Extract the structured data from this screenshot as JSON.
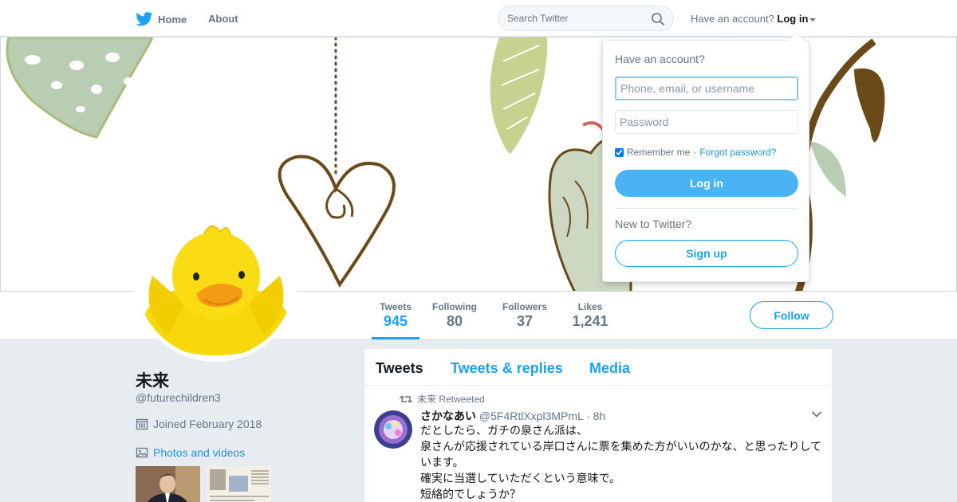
{
  "nav": {
    "home_label": "Home",
    "about_label": "About",
    "search_placeholder": "Search Twitter",
    "have_account_prefix": "Have an account?",
    "login_toggle_label": "Log in",
    "icons": [
      "twitter-bird-icon",
      "search-icon",
      "caret-down-icon"
    ]
  },
  "profile": {
    "name": "未来",
    "handle": "@futurechildren3",
    "joined": "Joined February 2018",
    "photos_link": "Photos and videos"
  },
  "stats": [
    {
      "label": "Tweets",
      "value": "945",
      "active": true
    },
    {
      "label": "Following",
      "value": "80",
      "active": false
    },
    {
      "label": "Followers",
      "value": "37",
      "active": false
    },
    {
      "label": "Likes",
      "value": "1,241",
      "active": false
    }
  ],
  "follow_label": "Follow",
  "timeline": {
    "tabs": [
      "Tweets",
      "Tweets & replies",
      "Media"
    ],
    "tweet": {
      "retweet_context": "未来 Retweeted",
      "author_name": "さかなあい",
      "author_handle": "@5F4RtlXxpl3MPmL",
      "time": "· 8h",
      "lines": [
        "だとしたら、ガチの泉さん派は、",
        "泉さんが応援されている岸口さんに票を集めた方がいいのかな、と思ったりしています。",
        "確実に当選していただくという意味で。",
        "短絡的でしょうか？"
      ]
    }
  },
  "login_dropdown": {
    "title": "Have an account?",
    "username_placeholder": "Phone, email, or username",
    "password_placeholder": "Password",
    "remember_label": "Remember me",
    "separator": "·",
    "forgot_label": "Forgot password?",
    "login_button": "Log in",
    "new_prompt": "New to Twitter?",
    "signup_button": "Sign up"
  },
  "colors": {
    "brand_blue": "#1da1f2",
    "login_button_blue": "#4ab3f4",
    "page_background": "#e6ecf0"
  }
}
